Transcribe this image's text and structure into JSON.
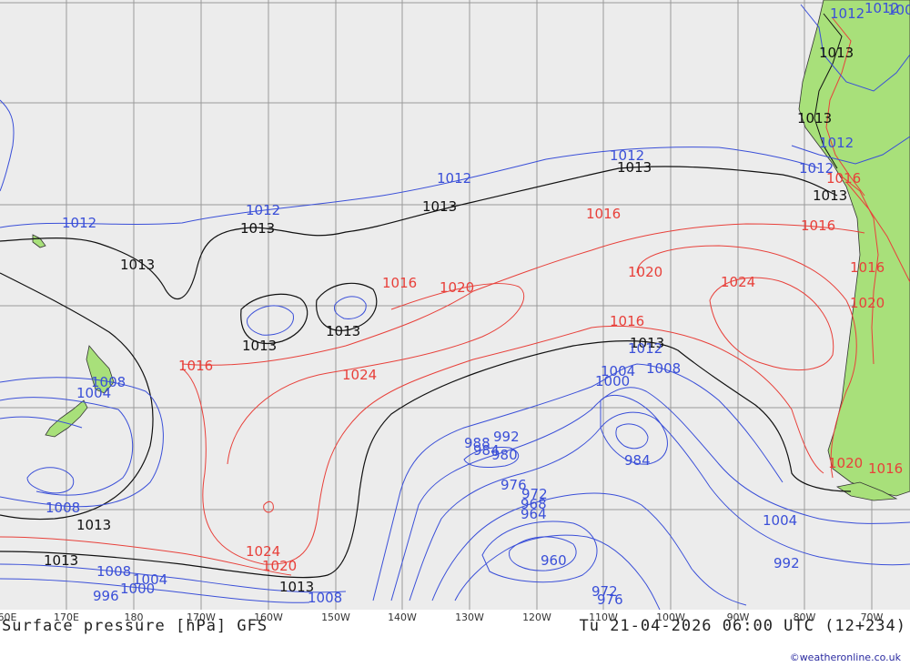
{
  "map": {
    "title": "Surface pressure [hPa] GFS",
    "valid_time": "Tu 21-04-2026 06:00 UTC (12+234)",
    "credit": "©weatheronline.co.uk",
    "colors": {
      "ocean": "#ececec",
      "land": "#a8e07a",
      "grid": "#9a9a9a",
      "isobar_low": "#3a4fd8",
      "isobar_high": "#e8403a",
      "isobar_ref": "#111111"
    },
    "lon_ticks": [
      "60E",
      "170E",
      "180",
      "170W",
      "160W",
      "150W",
      "140W",
      "130W",
      "120W",
      "110W",
      "100W",
      "90W",
      "80W",
      "70W"
    ],
    "isobar_labels": [
      {
        "text": "1012",
        "color": "blue"
      },
      {
        "text": "1012",
        "color": "blue"
      },
      {
        "text": "1012",
        "color": "blue"
      },
      {
        "text": "1012",
        "color": "blue"
      },
      {
        "text": "1012",
        "color": "blue"
      },
      {
        "text": "1012",
        "color": "blue"
      },
      {
        "text": "1012",
        "color": "blue"
      },
      {
        "text": "1012",
        "color": "blue"
      },
      {
        "text": "1008",
        "color": "blue"
      },
      {
        "text": "1013",
        "color": "black"
      },
      {
        "text": "1013",
        "color": "black"
      },
      {
        "text": "1013",
        "color": "black"
      },
      {
        "text": "1013",
        "color": "black"
      },
      {
        "text": "1013",
        "color": "black"
      },
      {
        "text": "1013",
        "color": "black"
      },
      {
        "text": "1013",
        "color": "black"
      },
      {
        "text": "1013",
        "color": "black"
      },
      {
        "text": "1013",
        "color": "black"
      },
      {
        "text": "1013",
        "color": "black"
      },
      {
        "text": "1013",
        "color": "black"
      },
      {
        "text": "1013",
        "color": "black"
      },
      {
        "text": "1013",
        "color": "black"
      },
      {
        "text": "1016",
        "color": "red"
      },
      {
        "text": "1016",
        "color": "red"
      },
      {
        "text": "1016",
        "color": "red"
      },
      {
        "text": "1016",
        "color": "red"
      },
      {
        "text": "1016",
        "color": "red"
      },
      {
        "text": "1016",
        "color": "red"
      },
      {
        "text": "1016",
        "color": "red"
      },
      {
        "text": "1016",
        "color": "red"
      },
      {
        "text": "1020",
        "color": "red"
      },
      {
        "text": "1020",
        "color": "red"
      },
      {
        "text": "1020",
        "color": "red"
      },
      {
        "text": "1020",
        "color": "red"
      },
      {
        "text": "1020",
        "color": "red"
      },
      {
        "text": "1024",
        "color": "red"
      },
      {
        "text": "1024",
        "color": "red"
      },
      {
        "text": "1024",
        "color": "red"
      },
      {
        "text": "1008",
        "color": "blue"
      },
      {
        "text": "1004",
        "color": "blue"
      },
      {
        "text": "1008",
        "color": "blue"
      },
      {
        "text": "1008",
        "color": "blue"
      },
      {
        "text": "1004",
        "color": "blue"
      },
      {
        "text": "1000",
        "color": "blue"
      },
      {
        "text": "996",
        "color": "blue"
      },
      {
        "text": "1008",
        "color": "blue"
      },
      {
        "text": "1004",
        "color": "blue"
      },
      {
        "text": "1008",
        "color": "blue"
      },
      {
        "text": "1012",
        "color": "blue"
      },
      {
        "text": "1000",
        "color": "blue"
      },
      {
        "text": "992",
        "color": "blue"
      },
      {
        "text": "988",
        "color": "blue"
      },
      {
        "text": "984",
        "color": "blue"
      },
      {
        "text": "980",
        "color": "blue"
      },
      {
        "text": "984",
        "color": "blue"
      },
      {
        "text": "976",
        "color": "blue"
      },
      {
        "text": "972",
        "color": "blue"
      },
      {
        "text": "968",
        "color": "blue"
      },
      {
        "text": "964",
        "color": "blue"
      },
      {
        "text": "960",
        "color": "blue"
      },
      {
        "text": "972",
        "color": "blue"
      },
      {
        "text": "976",
        "color": "blue"
      },
      {
        "text": "1004",
        "color": "blue"
      },
      {
        "text": "992",
        "color": "blue"
      },
      {
        "text": "1008",
        "color": "blue"
      },
      {
        "text": "1012",
        "color": "blue"
      }
    ]
  }
}
